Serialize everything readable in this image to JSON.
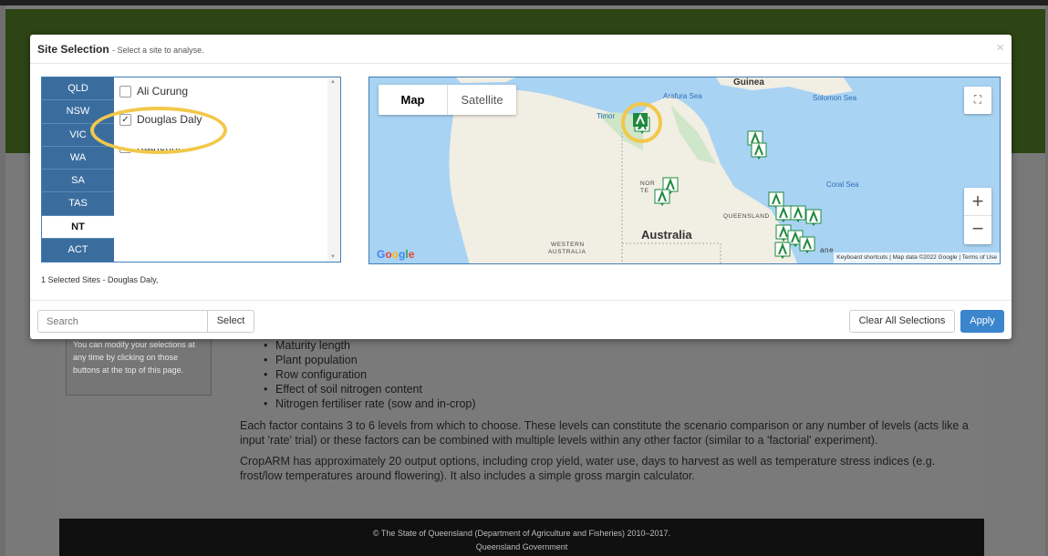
{
  "modal": {
    "title": "Site Selection",
    "subtitle": "- Select a site to analyse.",
    "close": "×",
    "states": [
      "QLD",
      "NSW",
      "VIC",
      "WA",
      "SA",
      "TAS",
      "NT",
      "ACT"
    ],
    "active_state": "NT",
    "sites": [
      {
        "label": "Ali Curung",
        "checked": false
      },
      {
        "label": "Douglas Daly",
        "checked": true
      },
      {
        "label": "Katherine",
        "checked": false
      }
    ],
    "selected_info": "1 Selected Sites - Douglas Daly,",
    "search_placeholder": "Search",
    "select_label": "Select",
    "clear_label": "Clear All Selections",
    "apply_label": "Apply"
  },
  "map": {
    "type_map": "Map",
    "type_satellite": "Satellite",
    "zoom_in": "+",
    "zoom_out": "−",
    "labels": {
      "guinea": "Guinea",
      "arafura": "Arafura Sea",
      "solomon": "Solomon Sea",
      "timor": "Timor",
      "coral": "Coral Sea",
      "queensland": "QUEENSLAND",
      "australia": "Australia",
      "western": "WESTERN",
      "western2": "AUSTRALIA",
      "nor": "NOR",
      "ter": "TE",
      "ane": "ane"
    },
    "attribution": "Keyboard shortcuts | Map data ©2022 Google | Terms of Use",
    "google": "Google"
  },
  "background": {
    "sidenote": "You can modify your selections at any time by clicking on those buttons at the top of this page.",
    "bullets": [
      "Maturity length",
      "Plant population",
      "Row configuration",
      "Effect of soil nitrogen content",
      "Nitrogen fertiliser rate (sow and in-crop)"
    ],
    "para1": "Each factor contains 3 to 6 levels from which to choose. These levels can constitute the scenario comparison or any number of levels (acts like a input 'rate' trial) or these factors can be combined with multiple levels within any other factor (similar to a 'factorial' experiment).",
    "para2": "CropARM has approximately 20 output options, including crop yield, water use, days to harvest as well as temperature stress indices (e.g. frost/low temperatures around flowering). It also includes a simple gross margin calculator.",
    "footer1": "© The State of Queensland (Department of Agriculture and Fisheries) 2010–2017.",
    "footer2": "Queensland Government"
  },
  "colors": {
    "tab": "#3a6d9e",
    "apply": "#3a85cc",
    "highlight": "#f2c84b",
    "marker": "#1e8a3e"
  }
}
